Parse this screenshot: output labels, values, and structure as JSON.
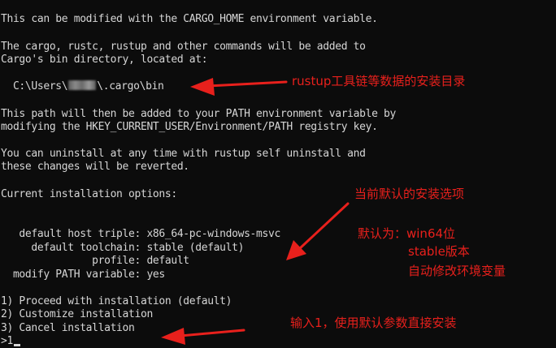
{
  "terminal": {
    "lines": [
      "This can be modified with the CARGO_HOME environment variable.",
      "",
      "The cargo, rustc, rustup and other commands will be added to",
      "Cargo's bin directory, located at:",
      "",
      "  C:\\Users\\",
      "",
      "This path will then be added to your PATH environment variable by",
      "modifying the HKEY_CURRENT_USER/Environment/PATH registry key.",
      "",
      "You can uninstall at any time with rustup self uninstall and",
      "these changes will be reverted.",
      "",
      "Current installation options:",
      "",
      "",
      "   default host triple: x86_64-pc-windows-msvc",
      "     default toolchain: stable (default)",
      "               profile: default",
      "  modify PATH variable: yes",
      "",
      "1) Proceed with installation (default)",
      "2) Customize installation",
      "3) Cancel installation",
      ">1"
    ],
    "path_suffix": "\\.cargo\\bin"
  },
  "annotations": {
    "toolchain_dir": "rustup工具链等数据的安装目录",
    "current_options": "当前默认的安装选项",
    "default_win64": "默认为：win64位",
    "stable_version": "stable版本",
    "auto_env": "自动修改环境变量",
    "input_one": "输入1，使用默认参数直接安装"
  },
  "colors": {
    "background": "#0c0c0c",
    "terminal_text": "#d6d6d6",
    "annotation_red": "#e8201c"
  }
}
